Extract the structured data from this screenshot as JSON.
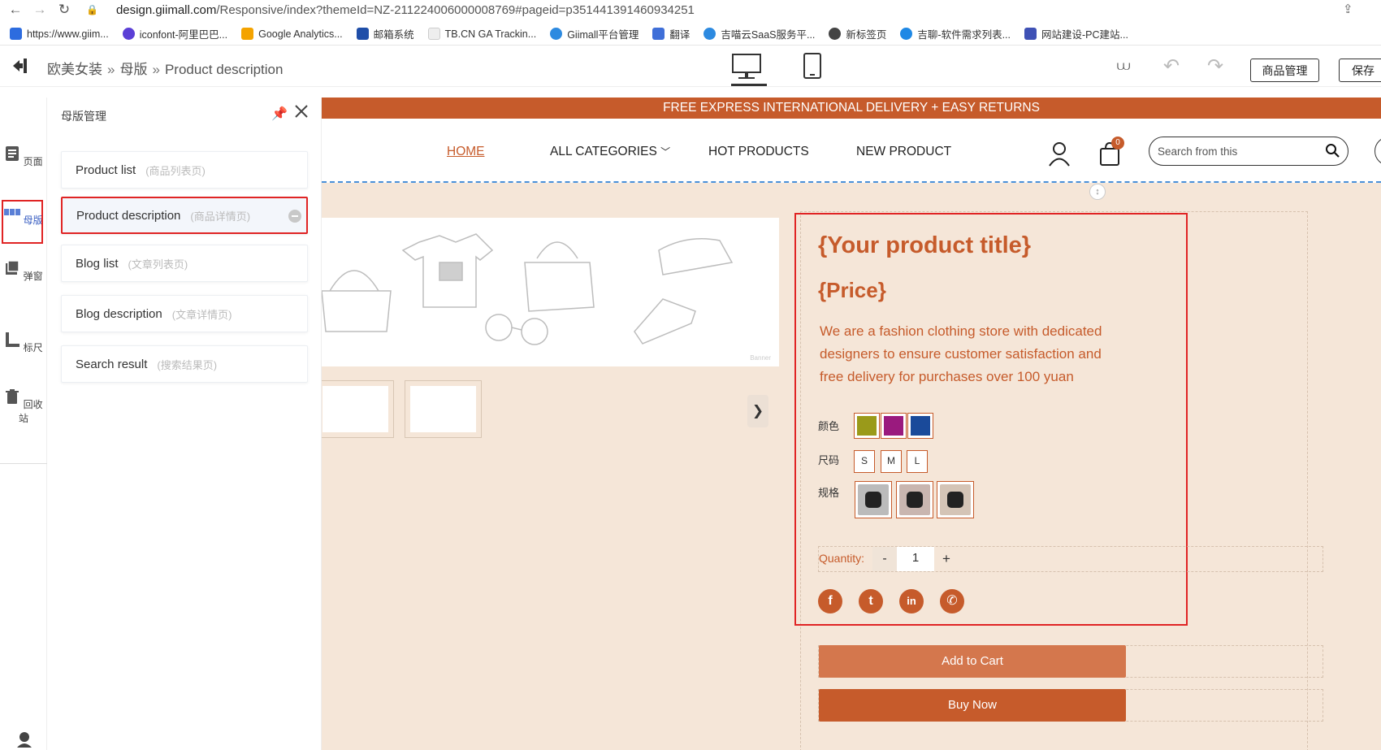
{
  "browser": {
    "url_domain": "design.giimall.com",
    "url_path": "/Responsive/index?themeId=NZ-211224006000008769#pageid=p351441391460934251",
    "bookmarks": [
      {
        "label": "https://www.giim...",
        "color": "#2d6cdf"
      },
      {
        "label": "iconfont-阿里巴巴...",
        "color": "#5b3fd6"
      },
      {
        "label": "Google Analytics...",
        "color": "#f4a300"
      },
      {
        "label": "邮箱系统",
        "color": "#1f4ea8"
      },
      {
        "label": "TB.CN GA Trackin...",
        "color": "#dddddd"
      },
      {
        "label": "Giimall平台管理",
        "color": "#2d8ae0"
      },
      {
        "label": "翻译",
        "color": "#3f6fd8"
      },
      {
        "label": "吉喵云SaaS服务平...",
        "color": "#2d8ae0"
      },
      {
        "label": "新标签页",
        "color": "#444444"
      },
      {
        "label": "吉聊-软件需求列表...",
        "color": "#1e88e5"
      },
      {
        "label": "网站建设-PC建站...",
        "color": "#3f51b5"
      }
    ]
  },
  "editor": {
    "breadcrumb": [
      "欧美女装",
      "母版",
      "Product description"
    ],
    "breadcrumb_sep": "»",
    "buttons": {
      "goods": "商品管理",
      "save": "保存"
    }
  },
  "rail": {
    "items": [
      {
        "label": "页面",
        "icon": "page-icon"
      },
      {
        "label": "母版",
        "icon": "template-icon"
      },
      {
        "label": "弹窗",
        "icon": "popup-icon"
      },
      {
        "label": "标尺",
        "icon": "ruler-icon"
      },
      {
        "label": "回收站",
        "icon": "trash-icon"
      }
    ]
  },
  "panel": {
    "title": "母版管理",
    "items": [
      {
        "label": "Product list",
        "sub": "(商品列表页)"
      },
      {
        "label": "Product description",
        "sub": "(商品详情页)"
      },
      {
        "label": "Blog list",
        "sub": "(文章列表页)"
      },
      {
        "label": "Blog description",
        "sub": "(文章详情页)"
      },
      {
        "label": "Search result",
        "sub": "(搜索结果页)"
      }
    ]
  },
  "site": {
    "promo": "FREE EXPRESS INTERNATIONAL DELIVERY + EASY RETURNS",
    "nav": {
      "home": "HOME",
      "categories": "ALL CATEGORIES",
      "hot": "HOT PRODUCTS",
      "new": "NEW PRODUCT"
    },
    "cart_count": "0",
    "search_placeholder": "Search from this",
    "banner_label": "Banner",
    "thumb_next": "❯",
    "accent": "#c65b2b"
  },
  "product": {
    "title": "{Your product title}",
    "price": "{Price}",
    "description": "We are a fashion clothing store with dedicated designers to ensure customer satisfaction and free delivery for purchases over 100 yuan",
    "labels": {
      "color": "颜色",
      "size": "尺码",
      "spec": "规格",
      "quantity": "Quantity:"
    },
    "colors": [
      "#9a9a1a",
      "#9a1a7e",
      "#1a4a9a"
    ],
    "sizes": [
      "S",
      "M",
      "L"
    ],
    "quantity": {
      "minus": "-",
      "value": "1",
      "plus": "+"
    },
    "social": [
      "f",
      "t",
      "in",
      "✆"
    ],
    "add_to_cart": "Add to Cart",
    "buy_now": "Buy Now"
  }
}
